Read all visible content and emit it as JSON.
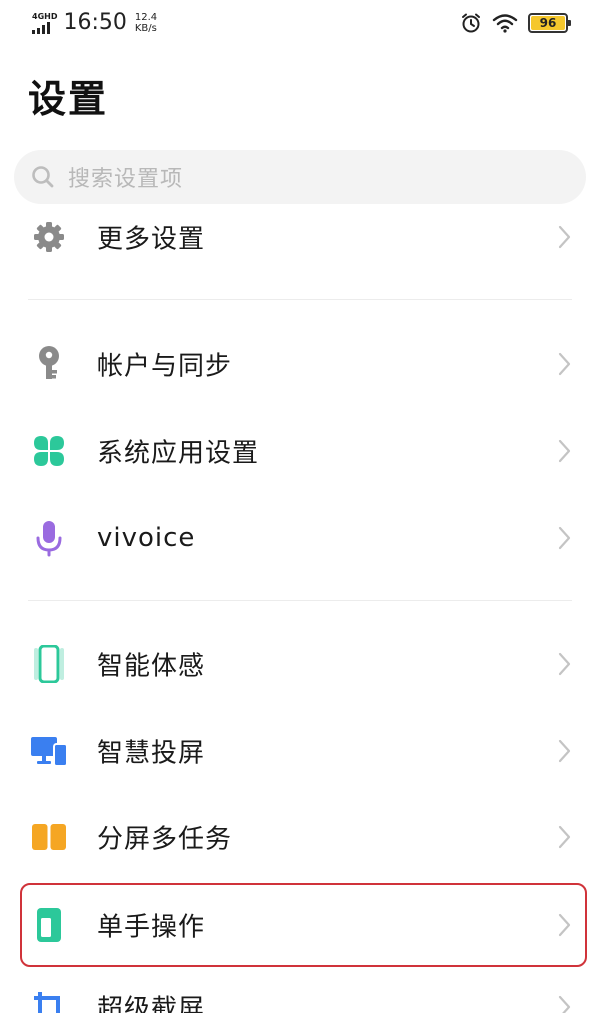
{
  "status_bar": {
    "network_type": "4GHD",
    "time": "16:50",
    "speed_value": "12.4",
    "speed_unit": "KB/s",
    "battery_level": "96",
    "icons": [
      "signal-icon",
      "alarm-icon",
      "wifi-icon",
      "battery-icon"
    ]
  },
  "page": {
    "title": "设置"
  },
  "search": {
    "placeholder": "搜索设置项"
  },
  "items": [
    {
      "label": "更多设置",
      "icon": "gear-icon"
    },
    {
      "label": "帐户与同步",
      "icon": "key-icon"
    },
    {
      "label": "系统应用设置",
      "icon": "apps-icon"
    },
    {
      "label": "vivoice",
      "icon": "microphone-icon"
    },
    {
      "label": "智能体感",
      "icon": "smart-motion-icon"
    },
    {
      "label": "智慧投屏",
      "icon": "screen-cast-icon"
    },
    {
      "label": "分屏多任务",
      "icon": "split-screen-icon"
    },
    {
      "label": "单手操作",
      "icon": "one-hand-icon",
      "highlighted": true
    },
    {
      "label": "超级截屏",
      "icon": "screenshot-icon"
    }
  ],
  "colors": {
    "highlight_border": "#d0333a",
    "green_accent": "#2cc89a",
    "purple_accent": "#9a6be0",
    "blue_accent": "#3a7ff0",
    "orange_accent": "#f5a623",
    "battery_fill": "#f5c72c"
  }
}
